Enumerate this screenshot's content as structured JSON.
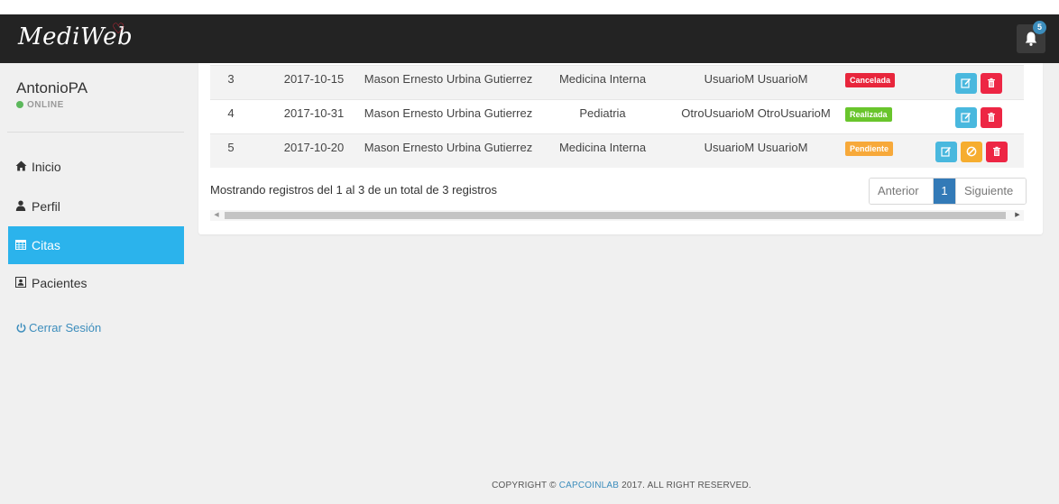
{
  "app": {
    "logo_text": "MediWeb"
  },
  "header": {
    "notification_count": "5"
  },
  "user": {
    "name": "AntonioPA",
    "status": "ONLINE"
  },
  "sidebar": {
    "items": [
      {
        "label": "Inicio",
        "icon": "home-icon"
      },
      {
        "label": "Perfil",
        "icon": "user-icon"
      },
      {
        "label": "Citas",
        "icon": "calendar-icon",
        "active": true
      },
      {
        "label": "Pacientes",
        "icon": "id-card-icon"
      }
    ],
    "logout_label": "Cerrar Sesión"
  },
  "table": {
    "rows": [
      {
        "num": "3",
        "fecha": "2017-10-15",
        "paciente": "Mason Ernesto Urbina Gutierrez",
        "especialidad": "Medicina Interna",
        "medico": "UsuarioM UsuarioM",
        "estado": "Cancelada",
        "estado_color": "#e8263c"
      },
      {
        "num": "4",
        "fecha": "2017-10-31",
        "paciente": "Mason Ernesto Urbina Gutierrez",
        "especialidad": "Pediatria",
        "medico": "OtroUsuarioM OtroUsuarioM",
        "estado": "Realizada",
        "estado_color": "#69c52c"
      },
      {
        "num": "5",
        "fecha": "2017-10-20",
        "paciente": "Mason Ernesto Urbina Gutierrez",
        "especialidad": "Medicina Interna",
        "medico": "UsuarioM UsuarioM",
        "estado": "Pendiente",
        "estado_color": "#f7a93a"
      }
    ],
    "info": "Mostrando registros del 1 al 3 de un total de 3 registros"
  },
  "pagination": {
    "prev": "Anterior",
    "current": "1",
    "next": "Siguiente"
  },
  "footer": {
    "prefix": "COPYRIGHT © ",
    "link": "CAPCOINLAB",
    "suffix": " 2017. ALL RIGHT RESERVED."
  },
  "colors": {
    "accent": "#2bb3ec",
    "topbar": "#232323",
    "edit": "#49b8de",
    "delete": "#ed2644",
    "cancel": "#f6ad2f"
  }
}
